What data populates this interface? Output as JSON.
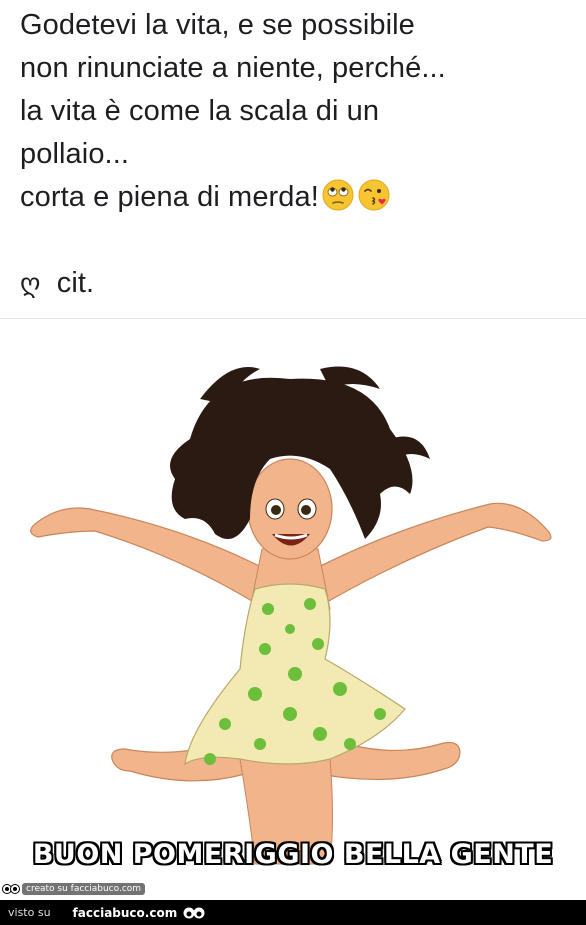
{
  "post": {
    "lines": [
      "Godetevi la vita, e se possibile",
      "non rinunciate a niente, perché...",
      "la vita è come la scala di un",
      "pollaio...",
      "corta e piena di merda!"
    ],
    "cit_glyph": "ღ",
    "cit_text": "cit.",
    "emojis": [
      "eye-roll-emoji",
      "kissing-face-emoji"
    ]
  },
  "image": {
    "caption": "BUON POMERIGGIO BELLA GENTE",
    "badge": "creato su facciabuco.com"
  },
  "footer": {
    "visto_label": "visto su",
    "site": "facciabuco.com"
  },
  "colors": {
    "text": "#1c1e21",
    "dress": "#f3e9b3",
    "dots": "#6cbf3a",
    "hair": "#2a1a12",
    "skin": "#f2b48a"
  }
}
